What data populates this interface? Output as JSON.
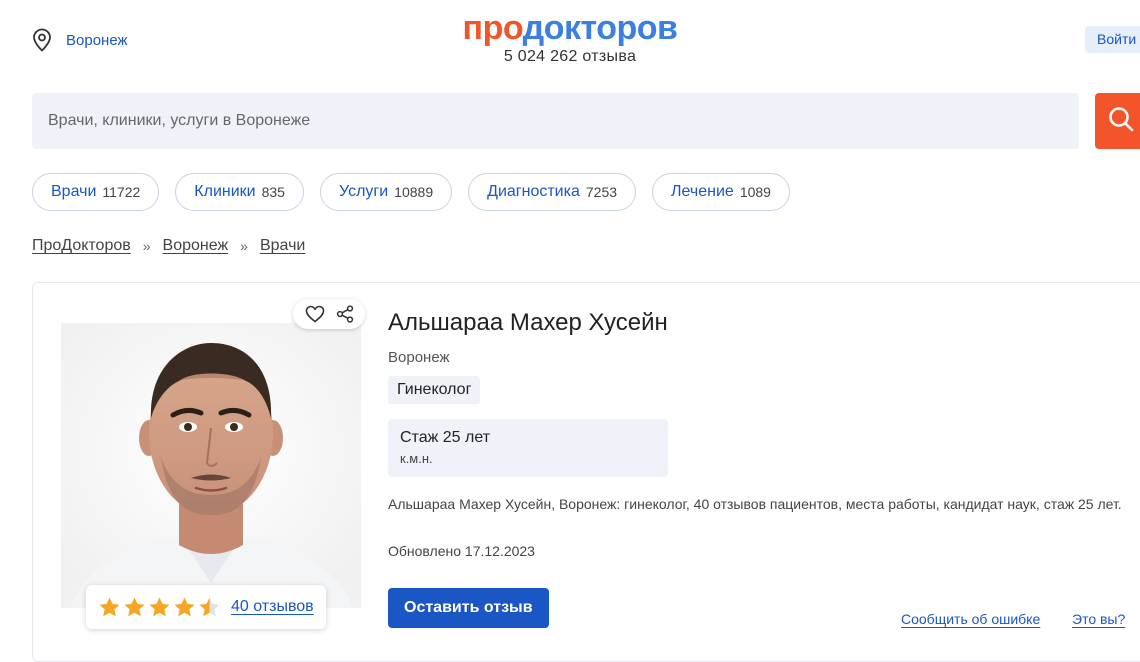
{
  "header": {
    "city": "Воронеж",
    "logo_pro": "про",
    "logo_doc": "докторов",
    "review_count": "5 024 262 отзыва",
    "login_label": "Войти"
  },
  "search": {
    "placeholder": "Врачи, клиники, услуги в Воронеже"
  },
  "tabs": [
    {
      "label": "Врачи",
      "count": "11722"
    },
    {
      "label": "Клиники",
      "count": "835"
    },
    {
      "label": "Услуги",
      "count": "10889"
    },
    {
      "label": "Диагностика",
      "count": "7253"
    },
    {
      "label": "Лечение",
      "count": "1089"
    }
  ],
  "breadcrumb": {
    "items": [
      "ПроДокторов",
      "Воронеж",
      "Врачи"
    ],
    "separator": "»"
  },
  "doctor": {
    "name": "Альшараа Махер Хусейн",
    "city": "Воронеж",
    "specialty": "Гинеколог",
    "experience": "Стаж 25 лет",
    "degree": "к.м.н.",
    "description": "Альшараа Махер Хусейн, Воронеж: гинеколог, 40 отзывов пациентов, места работы, кандидат наук, стаж 25 лет.",
    "updated": "Обновлено 17.12.2023",
    "rating_stars": 4.5,
    "reviews_link": "40 отзывов",
    "leave_review_label": "Оставить отзыв",
    "report_error_label": "Сообщить об ошибке",
    "what_is_it_label": "Это вы?"
  },
  "colors": {
    "brand_orange": "#f3542a",
    "brand_blue": "#3b7fe0",
    "link_blue": "#1a56c4",
    "star": "#f5a623",
    "light_bg": "#eff3f9"
  }
}
